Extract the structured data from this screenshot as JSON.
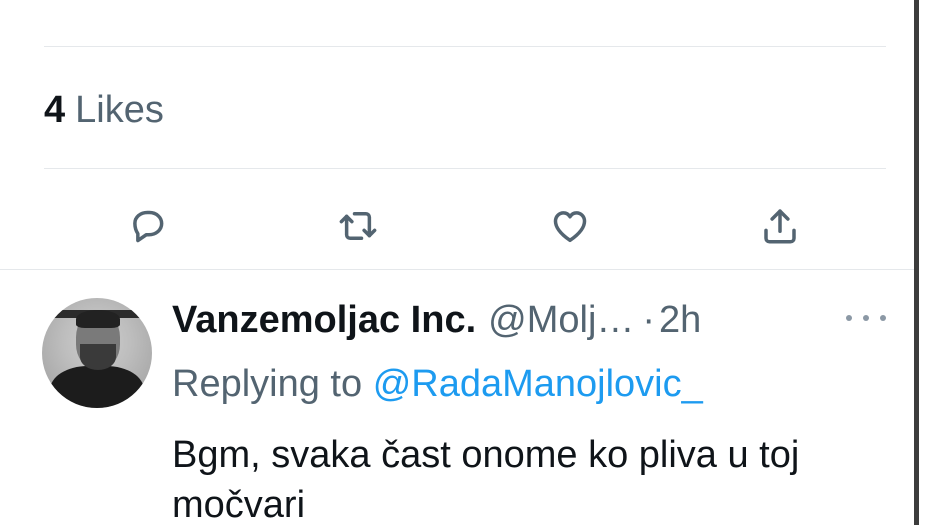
{
  "likes": {
    "count": "4",
    "label": "Likes"
  },
  "actions": [
    {
      "icon": "reply-icon"
    },
    {
      "icon": "retweet-icon"
    },
    {
      "icon": "like-icon"
    },
    {
      "icon": "share-icon"
    }
  ],
  "reply": {
    "display_name": "Vanzemoljac Inc.",
    "handle": "@Molj…",
    "separator": "·",
    "time": "2h",
    "replying_prefix": "Replying to",
    "replying_mention": "@RadaManojlovic_",
    "text": "Bgm, svaka čast onome ko pliva u toj močvari"
  },
  "colors": {
    "text": "#0f1419",
    "secondary": "#536471",
    "accent": "#1d9bf0",
    "divider": "#e5e8eb"
  }
}
